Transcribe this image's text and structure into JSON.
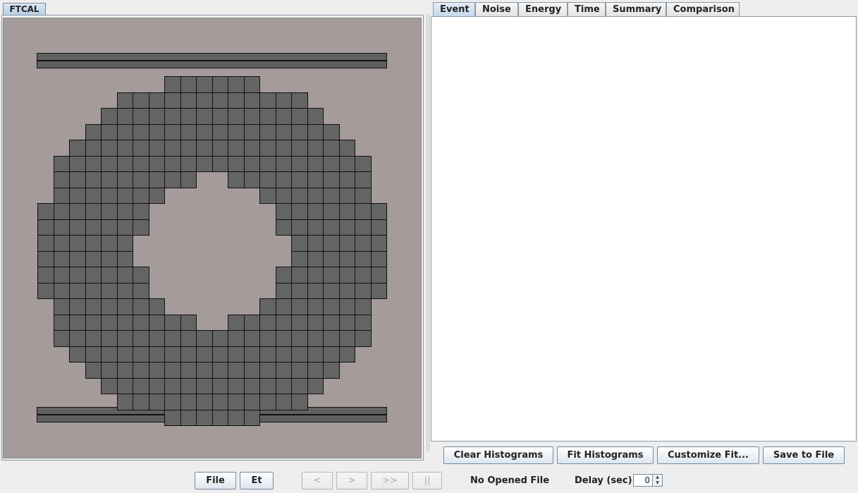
{
  "left_panel": {
    "tab_label": "FTCAL"
  },
  "right_panel": {
    "tabs": [
      {
        "label": "Event",
        "selected": true
      },
      {
        "label": "Noise",
        "selected": false
      },
      {
        "label": "Energy",
        "selected": false
      },
      {
        "label": "Time",
        "selected": false
      },
      {
        "label": "Summary",
        "selected": false
      },
      {
        "label": "Comparison",
        "selected": false
      }
    ],
    "buttons": {
      "clear": "Clear Histograms",
      "fit": "Fit Histograms",
      "customize": "Customize Fit...",
      "save": "Save to File"
    }
  },
  "bottom_bar": {
    "file": "File",
    "et": "Et",
    "prev": "<",
    "next": ">",
    "fast_forward": ">>",
    "pause": "||",
    "status": "No Opened File",
    "delay_label": "Delay (sec)",
    "delay_value": "0"
  },
  "colors": {
    "canvas_bg": "#a49b9a",
    "crystal": "#646464",
    "tab_selected": "#c5d8ec"
  }
}
